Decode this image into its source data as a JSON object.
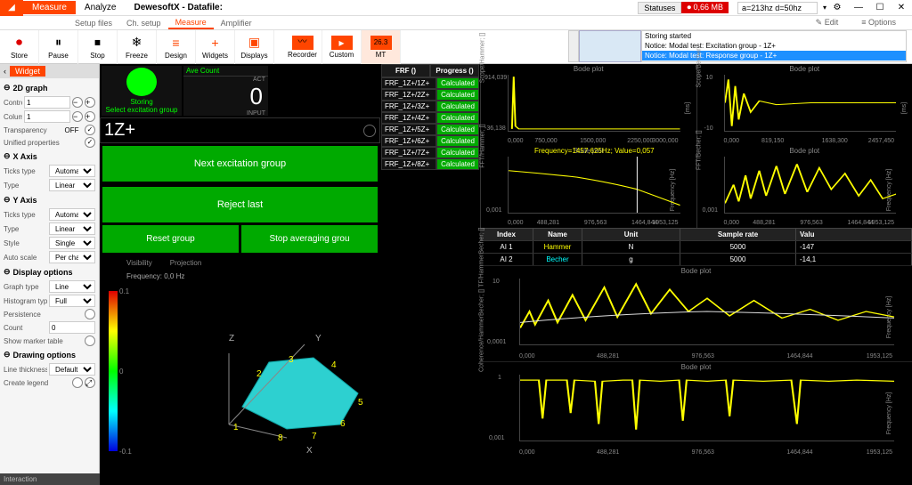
{
  "app": {
    "title": "DewesoftX - Datafile:"
  },
  "tabs": {
    "measure": "Measure",
    "analyze": "Analyze"
  },
  "sub_tabs": {
    "setup_files": "Setup files",
    "ch_setup": "Ch. setup",
    "measure": "Measure",
    "amplifier": "Amplifier",
    "edit": "Edit",
    "options": "Options"
  },
  "status": {
    "label": "Statuses",
    "mem": "0,66 MB",
    "search_ph": "a=213hz d=50hz"
  },
  "toolbar": {
    "store": "Store",
    "pause": "Pause",
    "stop": "Stop",
    "freeze": "Freeze",
    "design": "Design",
    "widgets": "Widgets",
    "displays": "Displays",
    "recorder": "Recorder",
    "custom": "Custom",
    "mt": "MT"
  },
  "notices": {
    "n1": "Storing started",
    "n2": "Notice: Modal test: Excitation group - 1Z+",
    "n3": "Notice: Modal test: Response group - 1Z+"
  },
  "sidebar": {
    "widget": "Widget",
    "g2d": "2D graph",
    "controls": "Controls",
    "controls_v": "1",
    "columns": "Columns",
    "columns_v": "1",
    "transparency": "Transparency",
    "transparency_v": "OFF",
    "unified": "Unified properties",
    "xaxis": "X Axis",
    "yaxis": "Y Axis",
    "ticks_type": "Ticks type",
    "ticks_v": "Automatic",
    "type": "Type",
    "type_v": "Linear",
    "style": "Style",
    "style_v": "Single",
    "auto_scale": "Auto scale",
    "auto_v": "Per channel",
    "display_opts": "Display options",
    "graph_type": "Graph type",
    "graph_v": "Line",
    "hist_type": "Histogram type",
    "hist_v": "Full",
    "persistence": "Persistence",
    "count": "Count",
    "count_v": "0",
    "marker_table": "Show marker table",
    "drawing_opts": "Drawing options",
    "line_thk": "Line thickness",
    "line_v": "Default",
    "create_legend": "Create legend",
    "interaction": "Interaction"
  },
  "status_panel": {
    "storing": "Storing",
    "select_group": "Select excitation group",
    "ave_count": "Ave Count",
    "act": "ACT",
    "val": "0",
    "input": "INPUT",
    "channel": "1Z+"
  },
  "buttons": {
    "next": "Next excitation group",
    "reject": "Reject last",
    "reset": "Reset group",
    "stop_avg": "Stop averaging grou"
  },
  "frf": {
    "h_name": "FRF ()",
    "h_prog": "Progress ()",
    "rows": [
      {
        "n": "FRF_1Z+/1Z+",
        "s": "Calculated"
      },
      {
        "n": "FRF_1Z+/2Z+",
        "s": "Calculated"
      },
      {
        "n": "FRF_1Z+/3Z+",
        "s": "Calculated"
      },
      {
        "n": "FRF_1Z+/4Z+",
        "s": "Calculated"
      },
      {
        "n": "FRF_1Z+/5Z+",
        "s": "Calculated"
      },
      {
        "n": "FRF_1Z+/6Z+",
        "s": "Calculated"
      },
      {
        "n": "FRF_1Z+/7Z+",
        "s": "Calculated"
      },
      {
        "n": "FRF_1Z+/8Z+",
        "s": "Calculated"
      }
    ]
  },
  "viz3d": {
    "visibility": "Visibility",
    "projection": "Projection",
    "freq": "Frequency: 0,0 Hz",
    "cb_top": "0.1",
    "cb_mid": "0",
    "cb_bot": "-0.1",
    "ax_x": "X",
    "ax_y": "Y",
    "ax_z": "Z",
    "pt1": "1",
    "pt2": "2",
    "pt3": "3",
    "pt4": "4",
    "pt5": "5",
    "pt6": "6",
    "pt7": "7",
    "pt8": "8"
  },
  "plots": {
    "bode": "Bode plot",
    "overlay": "Frequency=1457,625Hz; Value=0,057",
    "scope_y": "Scope/Hammer; []",
    "scope_r": "[ms]",
    "scope2_y": "Scope/Becher;",
    "fft_y": "FFT/Hammer; []",
    "fft_r": "Frequency [Hz]",
    "fft2_y": "FFT/Becher; []",
    "tf_y": "TF/HammerBecher; []",
    "coh_y": "Coherence/HammerBecher; []",
    "y_sc1a": "914,039",
    "y_sc1b": "-36,138",
    "y_sc2": "10",
    "y_sc2b": "-10",
    "y_fft": "0,001",
    "y_tf_a": "10",
    "y_tf_b": "0,0001",
    "y_coh_a": "1",
    "y_coh_b": "0,001",
    "xt1_0": "0,000",
    "xt1_1": "750,000",
    "xt1_2": "1500,000",
    "xt1_3": "2250,000",
    "xt1_4": "3000,000",
    "xt2_0": "0,000",
    "xt2_1": "819,150",
    "xt2_2": "1638,300",
    "xt2_3": "2457,450",
    "xt3_0": "0,000",
    "xt3_1": "488,281",
    "xt3_2": "976,563",
    "xt3_3": "1464,844",
    "xt3_4": "1953,125"
  },
  "table": {
    "h_idx": "Index",
    "h_name": "Name",
    "h_unit": "Unit",
    "h_rate": "Sample rate",
    "h_val": "Valu",
    "r1_idx": "AI 1",
    "r1_name": "Hammer",
    "r1_unit": "N",
    "r1_rate": "5000",
    "r1_val": "-147",
    "r2_idx": "AI 2",
    "r2_name": "Becher",
    "r2_unit": "g",
    "r2_rate": "5000",
    "r2_val": "-14,1"
  },
  "chart_data": [
    {
      "type": "line",
      "title": "Bode plot (Scope/Hammer)",
      "xlabel": "ms",
      "ylabel": "Scope/Hammer []",
      "xlim": [
        0,
        3000
      ],
      "ylim": [
        -36.138,
        914.039
      ],
      "note": "impulse near t≈0 then decay to 0"
    },
    {
      "type": "line",
      "title": "Bode plot (Scope/Becher)",
      "xlabel": "ms",
      "ylabel": "Scope/Becher []",
      "xlim": [
        0,
        2457.45
      ],
      "ylim": [
        -10,
        10
      ],
      "note": "damped oscillation"
    },
    {
      "type": "line",
      "title": "Bode plot (FFT/Hammer)",
      "xlabel": "Frequency [Hz]",
      "ylabel": "FFT/Hammer []",
      "xlim": [
        0,
        1953.125
      ],
      "ylim": [
        0.001,
        1
      ],
      "note": "log-y, marker at 1457.625 Hz value 0.057"
    },
    {
      "type": "line",
      "title": "Bode plot (FFT/Becher)",
      "xlabel": "Frequency [Hz]",
      "ylabel": "FFT/Becher []",
      "xlim": [
        0,
        1953.125
      ],
      "ylim": [
        0.001,
        1
      ]
    },
    {
      "type": "line",
      "title": "Bode plot (TF/HammerBecher)",
      "xlabel": "Frequency [Hz]",
      "ylabel": "TF []",
      "xlim": [
        0,
        1953.125
      ],
      "ylim": [
        0.0001,
        10
      ]
    },
    {
      "type": "line",
      "title": "Bode plot (Coherence/HammerBecher)",
      "xlabel": "Frequency [Hz]",
      "ylabel": "Coherence []",
      "xlim": [
        0,
        1953.125
      ],
      "ylim": [
        0.001,
        1
      ]
    }
  ]
}
